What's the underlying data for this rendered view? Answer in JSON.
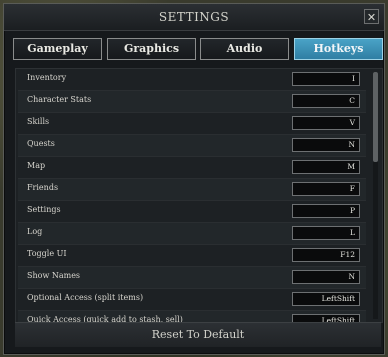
{
  "window": {
    "title": "SETTINGS",
    "close_glyph": "✕"
  },
  "tabs": [
    {
      "label": "Gameplay",
      "active": false
    },
    {
      "label": "Graphics",
      "active": false
    },
    {
      "label": "Audio",
      "active": false
    },
    {
      "label": "Hotkeys",
      "active": true
    }
  ],
  "hotkeys": [
    {
      "action": "Inventory",
      "key": "I"
    },
    {
      "action": "Character Stats",
      "key": "C"
    },
    {
      "action": "Skills",
      "key": "V"
    },
    {
      "action": "Quests",
      "key": "N"
    },
    {
      "action": "Map",
      "key": "M"
    },
    {
      "action": "Friends",
      "key": "F"
    },
    {
      "action": "Settings",
      "key": "P"
    },
    {
      "action": "Log",
      "key": "L"
    },
    {
      "action": "Toggle UI",
      "key": "F12"
    },
    {
      "action": "Show Names",
      "key": "N"
    },
    {
      "action": "Optional Access (split items)",
      "key": "LeftShift"
    },
    {
      "action": "Quick Access (quick add to stash, sell)",
      "key": "LeftShift"
    }
  ],
  "footer": {
    "reset_label": "Reset To Default"
  },
  "colors": {
    "accent": "#3b8fb6",
    "panel": "#1d2124",
    "window": "#16191c"
  }
}
